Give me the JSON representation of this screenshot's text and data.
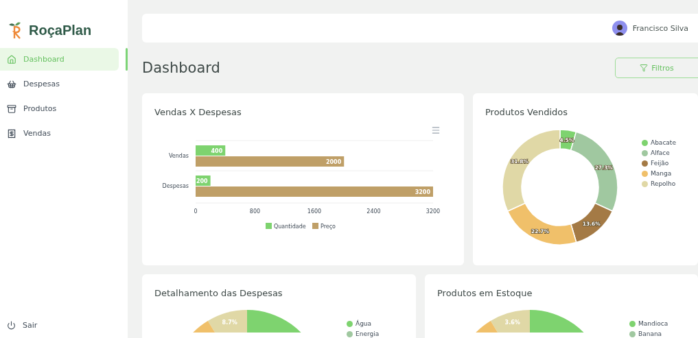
{
  "sidebar": {
    "logo": "RoçaPlan",
    "items": [
      {
        "label": "Dashboard",
        "selected": true
      },
      {
        "label": "Despesas",
        "selected": false
      },
      {
        "label": "Produtos",
        "selected": false
      },
      {
        "label": "Vendas",
        "selected": false
      }
    ],
    "logout": "Sair"
  },
  "header": {
    "user": "Francisco Silva"
  },
  "page": {
    "title": "Dashboard",
    "filter_button": "Filtros"
  },
  "cards": [
    {
      "kind": "bar",
      "title": "Vendas X Despesas",
      "chart_data": {
        "type": "bar",
        "orientation": "horizontal",
        "categories": [
          "Vendas",
          "Despesas"
        ],
        "series": [
          {
            "name": "Quantidade",
            "color": "#7ed36f",
            "values": [
              400,
              200
            ]
          },
          {
            "name": "Preço",
            "color": "#bf9f67",
            "values": [
              2000,
              3200
            ]
          }
        ],
        "xlim": [
          0,
          3200
        ],
        "xticks": [
          0,
          800,
          1600,
          2400,
          3200
        ],
        "data_labels": true,
        "legend": "bottom"
      }
    },
    {
      "kind": "donut",
      "title": "Produtos Vendidos",
      "chart_data": {
        "type": "donut",
        "categories": [
          "Abacate",
          "Alface",
          "Feijão",
          "Manga",
          "Repolho"
        ],
        "values": [
          4.5,
          27.3,
          13.6,
          22.7,
          31.8
        ],
        "colors": [
          "#7ed36f",
          "#a0c8a0",
          "#a47a45",
          "#f0c06a",
          "#e0d8a6"
        ],
        "value_labels": [
          "4.5%",
          "27.3%",
          "13.6%",
          "22.7%",
          "31.8%"
        ]
      }
    },
    {
      "kind": "pie",
      "title": "Detalhamento das Despesas",
      "slice_labels": [
        "8.7%"
      ],
      "legend": [
        {
          "label": "Água",
          "color": "#7ed36f"
        },
        {
          "label": "Energia",
          "color": "#a0c8a0"
        }
      ]
    },
    {
      "kind": "pie",
      "title": "Produtos em Estoque",
      "slice_labels": [
        "3.6%"
      ],
      "legend": [
        {
          "label": "Mandioca",
          "color": "#7ed36f"
        },
        {
          "label": "Banana",
          "color": "#a0c8a0"
        }
      ]
    }
  ]
}
